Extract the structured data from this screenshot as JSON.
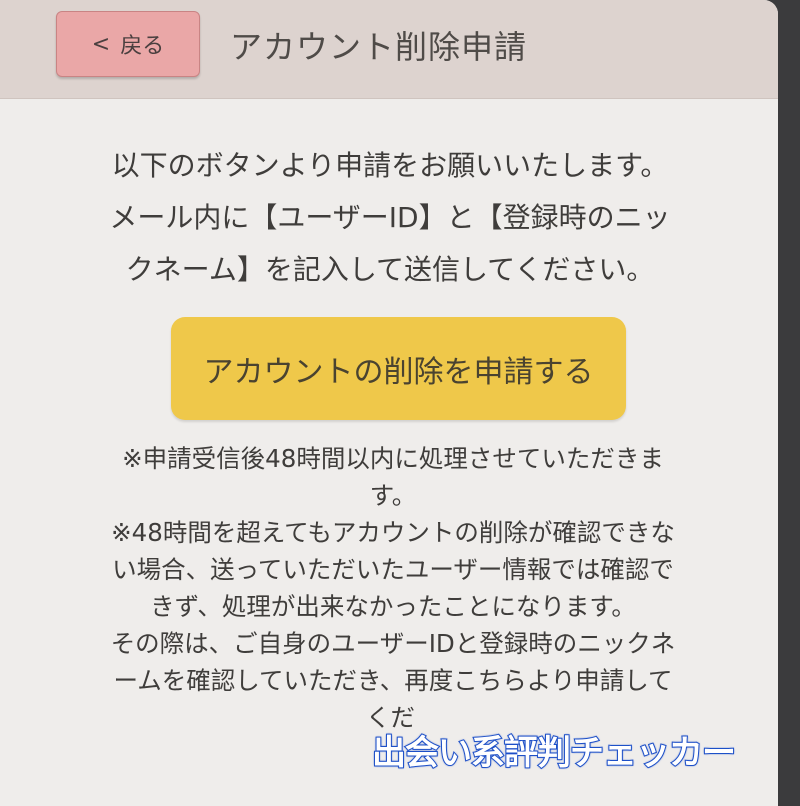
{
  "header": {
    "back_label": "戻る",
    "title": "アカウント削除申請"
  },
  "intro": {
    "lines": [
      "以下のボタンより申請をお願いいたします。",
      "メール内に【ユーザーID】と【登録時のニッ",
      "クネーム】を記入して送信してください。"
    ]
  },
  "apply_button": {
    "label": "アカウントの削除を申請する"
  },
  "notes": {
    "lines": [
      "※申請受信後48時間以内に処理させていただきま",
      "す。",
      "※48時間を超えてもアカウントの削除が確認できな",
      "い場合、送っていただいたユーザー情報では確認で",
      "きず、処理が出来なかったことになります。",
      "その際は、ご自身のユーザーIDと登録時のニックネ",
      "ームを確認していただき、再度こちらより申請して",
      "くだ"
    ]
  },
  "watermark": {
    "text": "出会い系評判チェッカー"
  },
  "colors": {
    "header_bg": "#ddd3cf",
    "back_button": "#eaa7a7",
    "apply_button": "#efc84a",
    "watermark_stroke": "#1e50c8"
  }
}
